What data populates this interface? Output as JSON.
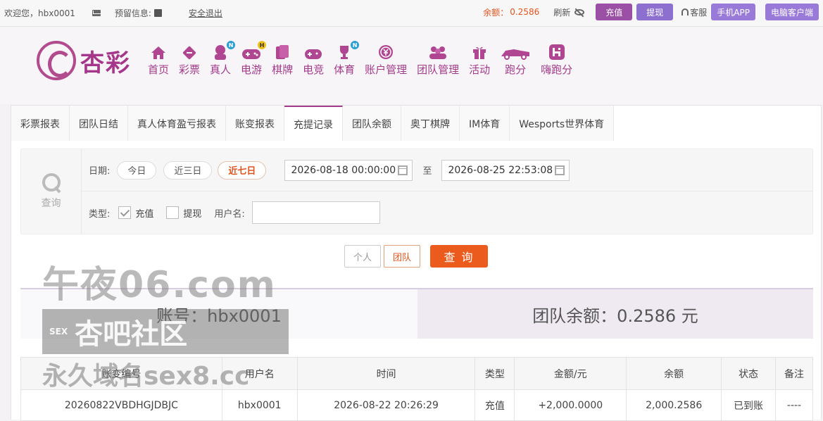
{
  "topbar": {
    "welcome": "欢迎您，hbx0001",
    "reserve": "预留信息:",
    "logout": "安全退出",
    "balance_label": "余额：",
    "balance_value": "0.2586",
    "refresh": "刷新",
    "recharge": "充值",
    "withdraw": "提现",
    "service": "客服",
    "mobile_app": "手机APP",
    "pc_client": "电脑客户端"
  },
  "logo": {
    "text": "杏彩"
  },
  "nav": [
    {
      "label": "首页",
      "icon": "home-icon"
    },
    {
      "label": "彩票",
      "icon": "ticket-icon"
    },
    {
      "label": "真人",
      "icon": "dealer-icon",
      "badge": "N"
    },
    {
      "label": "电游",
      "icon": "gamepad-icon",
      "badge": "H"
    },
    {
      "label": "棋牌",
      "icon": "cards-icon"
    },
    {
      "label": "电竞",
      "icon": "esports-gamepad-icon"
    },
    {
      "label": "体育",
      "icon": "trophy-icon",
      "badge": "N"
    },
    {
      "label": "账户管理",
      "icon": "yen-coin-icon"
    },
    {
      "label": "团队管理",
      "icon": "team-icon"
    },
    {
      "label": "活动",
      "icon": "gift-icon"
    },
    {
      "label": "跑分",
      "icon": "race-car-icon"
    },
    {
      "label": "嗨跑分",
      "icon": "hi-icon"
    }
  ],
  "tabs": [
    "彩票报表",
    "团队日结",
    "真人体育盈亏报表",
    "账变报表",
    "充提记录",
    "团队余额",
    "奥丁棋牌",
    "IM体育",
    "Wesports世界体育"
  ],
  "active_tab": "充提记录",
  "filter": {
    "query": "查询",
    "date_label": "日期:",
    "ranges": [
      "今日",
      "近三日",
      "近七日"
    ],
    "active_range": "近七日",
    "start": "2026-08-18 00:00:00",
    "to": "至",
    "end": "2026-08-25 22:53:08",
    "type_label": "类型:",
    "types": [
      {
        "label": "充值",
        "checked": true
      },
      {
        "label": "提现",
        "checked": false
      }
    ],
    "username_label": "用户名:",
    "username_value": ""
  },
  "actions": {
    "personal": "个人",
    "team": "团队",
    "query": "查 询"
  },
  "summary": {
    "account": "账号：hbx0001",
    "team_balance": "团队余额：0.2586 元"
  },
  "table": {
    "headers": [
      "账变编号",
      "用户名",
      "时间",
      "类型",
      "金额/元",
      "余额",
      "状态",
      "备注"
    ],
    "rows": [
      [
        "20260822VBDHGJDBJC",
        "hbx0001",
        "2026-08-22 20:26:29",
        "充值",
        "+2,000.0000",
        "2,000.2586",
        "已到账",
        "----"
      ]
    ]
  },
  "watermark": {
    "line1": "午夜06.com",
    "line2_small": "SEX",
    "line2": "杏吧社区",
    "line3": "永久域名sex8.cc"
  }
}
